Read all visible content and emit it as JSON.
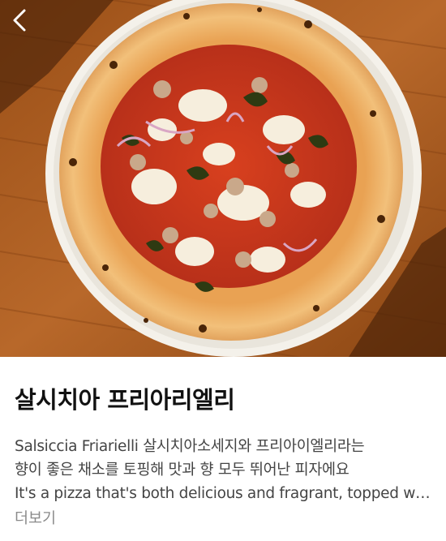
{
  "header": {
    "back_icon": "chevron-left-icon"
  },
  "hero_image": {
    "subject": "pizza-photo"
  },
  "menu_item": {
    "title": "살시치아 프리아리엘리",
    "description_lines": [
      "Salsiccia Friarielli 살시치아소세지와 프리아이엘리라는",
      "향이 좋은 채소를 토핑해 맛과 향 모두 뛰어난 피자에요",
      "It's a pizza that's both delicious and fragrant, topped with salsiccia sausage and friarielli"
    ],
    "more_label": "더보기"
  },
  "colors": {
    "title": "#111111",
    "body": "#444444",
    "muted": "#8a8a8a"
  }
}
